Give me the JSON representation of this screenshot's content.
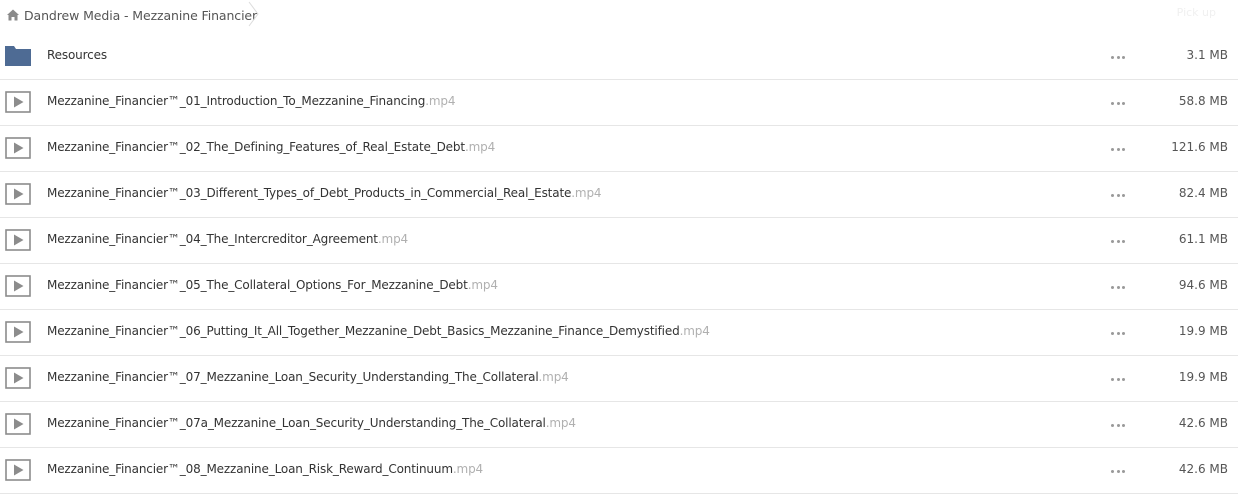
{
  "breadcrumb": {
    "home_icon": "home-icon",
    "path": "Dandrew Media - Mezzanine Financier",
    "right_text": "Pick up"
  },
  "files": [
    {
      "type": "folder",
      "icon": "folder-icon",
      "name": "Resources",
      "ext": "",
      "size": "3.1 MB"
    },
    {
      "type": "video",
      "icon": "play-icon",
      "name": "Mezzanine_Financier™_01_Introduction_To_Mezzanine_Financing",
      "ext": ".mp4",
      "size": "58.8 MB"
    },
    {
      "type": "video",
      "icon": "play-icon",
      "name": "Mezzanine_Financier™_02_The_Defining_Features_of_Real_Estate_Debt",
      "ext": ".mp4",
      "size": "121.6 MB"
    },
    {
      "type": "video",
      "icon": "play-icon",
      "name": "Mezzanine_Financier™_03_Different_Types_of_Debt_Products_in_Commercial_Real_Estate",
      "ext": ".mp4",
      "size": "82.4 MB"
    },
    {
      "type": "video",
      "icon": "play-icon",
      "name": "Mezzanine_Financier™_04_The_Intercreditor_Agreement",
      "ext": ".mp4",
      "size": "61.1 MB"
    },
    {
      "type": "video",
      "icon": "play-icon",
      "name": "Mezzanine_Financier™_05_The_Collateral_Options_For_Mezzanine_Debt",
      "ext": ".mp4",
      "size": "94.6 MB"
    },
    {
      "type": "video",
      "icon": "play-icon",
      "name": "Mezzanine_Financier™_06_Putting_It_All_Together_Mezzanine_Debt_Basics_Mezzanine_Finance_Demystified",
      "ext": ".mp4",
      "size": "19.9 MB"
    },
    {
      "type": "video",
      "icon": "play-icon",
      "name": "Mezzanine_Financier™_07_Mezzanine_Loan_Security_Understanding_The_Collateral",
      "ext": ".mp4",
      "size": "19.9 MB"
    },
    {
      "type": "video",
      "icon": "play-icon",
      "name": "Mezzanine_Financier™_07a_Mezzanine_Loan_Security_Understanding_The_Collateral",
      "ext": ".mp4",
      "size": "42.6 MB"
    },
    {
      "type": "video",
      "icon": "play-icon",
      "name": "Mezzanine_Financier™_08_Mezzanine_Loan_Risk_Reward_Continuum",
      "ext": ".mp4",
      "size": "42.6 MB"
    }
  ],
  "colors": {
    "folder": "#4e6b94",
    "play_icon": "#8c8c8c",
    "extension_text": "#b0b0b0",
    "row_divider": "#e6e6e6",
    "menu_dots": "#9a9a9a"
  }
}
